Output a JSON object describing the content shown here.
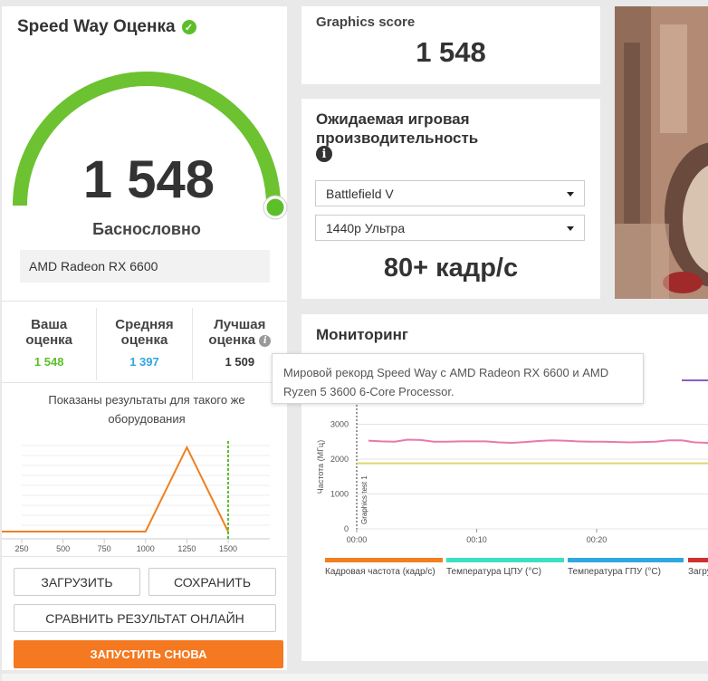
{
  "left": {
    "title": "Speed Way Оценка",
    "check_icon": "check-circle-icon",
    "score": "1 548",
    "gauge_fraction": 1.0,
    "rating": "Баснословно",
    "gpu": "AMD Radeon RX 6600",
    "columns": [
      {
        "label_line1": "Ваша",
        "label_line2": "оценка",
        "value": "1 548",
        "color": "#5cbf2a"
      },
      {
        "label_line1": "Средняя",
        "label_line2": "оценка",
        "value": "1 397",
        "color": "#2fa8e0"
      },
      {
        "label_line1": "Лучшая",
        "label_line2": "оценка",
        "value": "1 509",
        "color": "#333333"
      }
    ],
    "hist_caption": "Показаны результаты для такого же оборудования",
    "buttons": {
      "load": "ЗАГРУЗИТЬ",
      "save": "СОХРАНИТЬ",
      "compare": "СРАВНИТЬ РЕЗУЛЬТАТ ОНЛАЙН",
      "run_again": "ЗАПУСТИТЬ СНОВА"
    }
  },
  "histogram": {
    "x_ticks": [
      "250",
      "500",
      "750",
      "1000",
      "1250",
      "1500"
    ],
    "x_values": [
      250,
      500,
      750,
      1000,
      1250,
      1500
    ],
    "xlim": [
      140,
      1460
    ],
    "points": [
      [
        140,
        0
      ],
      [
        1000,
        0
      ],
      [
        1250,
        1
      ],
      [
        1500,
        0
      ]
    ],
    "marker_x": 1548,
    "line_color": "#f08020",
    "marker_color": "#5cbf2a"
  },
  "graphics_score": {
    "title": "Graphics score",
    "value": "1 548"
  },
  "performance": {
    "title_line1": "Ожидаемая игровая",
    "title_line2": "производительность",
    "info_icon": "info-icon",
    "game": "Battlefield V",
    "preset": "1440p Ультра",
    "fps": "80+ кадр/с"
  },
  "monitoring": {
    "title": "Мониторинг",
    "y_label": "Частота (МГц)",
    "y_ticks": [
      "0",
      "1000",
      "2000",
      "3000"
    ],
    "y_values": [
      0,
      1000,
      2000,
      3000
    ],
    "ylim": [
      0,
      3300
    ],
    "x_ticks": [
      "00:00",
      "00:10",
      "00:20"
    ],
    "x_values": [
      0,
      10,
      20
    ],
    "marker_label": "Graphics test 1",
    "series": [
      {
        "name": "pink",
        "color": "#e87aa8",
        "values": [
          2530,
          2510,
          2500,
          2560,
          2550,
          2500,
          2500,
          2510,
          2510,
          2510,
          2480,
          2470,
          2490,
          2520,
          2540,
          2530,
          2510,
          2500,
          2500,
          2490,
          2480,
          2490,
          2500,
          2540,
          2540,
          2480,
          2470
        ]
      },
      {
        "name": "yellow",
        "color": "#e0d470",
        "values": [
          1880,
          1880,
          1880,
          1880,
          1880,
          1880,
          1880,
          1880,
          1880,
          1880,
          1880,
          1880,
          1880,
          1880,
          1880,
          1880,
          1880,
          1880,
          1880,
          1880,
          1880,
          1880,
          1880,
          1880,
          1880,
          1880,
          1880
        ]
      }
    ],
    "purple_line_color": "#8a5cc8",
    "legend": [
      {
        "label": "Кадровая частота (кадр/с)",
        "color": "#f08020"
      },
      {
        "label": "Температура ЦПУ (°С)",
        "color": "#3ce0c0"
      },
      {
        "label": "Температура ГПУ (°С)",
        "color": "#2fa8e0"
      },
      {
        "label": "Загру",
        "color": "#d03030"
      }
    ]
  },
  "tooltip": {
    "text": "Мировой рекорд Speed Way с AMD Radeon RX 6600 и AMD Ryzen 5 3600 6-Core Processor."
  }
}
